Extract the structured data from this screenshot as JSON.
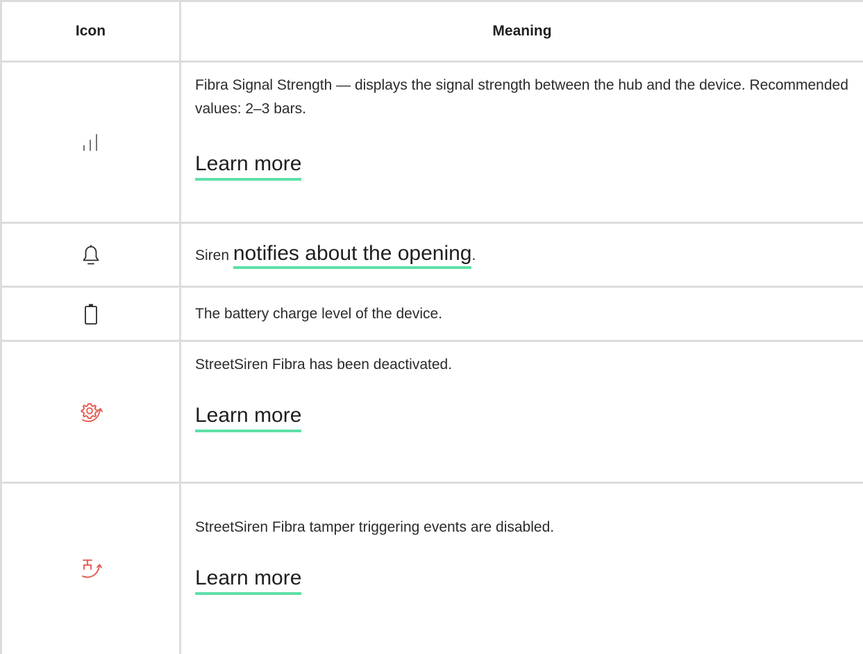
{
  "colors": {
    "border": "#dcdcdc",
    "link_underline": "#5fe0a8",
    "warning_icon": "#e4564a",
    "text": "#1f1f1f"
  },
  "table": {
    "headers": {
      "icon": "Icon",
      "meaning": "Meaning"
    },
    "rows": [
      {
        "icon": "signal-strength-icon",
        "text": "Fibra Signal Strength — displays the signal strength between the hub and the device. Recommended values: 2–3 bars.",
        "link": "Learn more"
      },
      {
        "icon": "bell-icon",
        "text_before": "Siren",
        "link": "notifies about the opening",
        "text_after": "."
      },
      {
        "icon": "battery-icon",
        "text": "The battery charge level of the device."
      },
      {
        "icon": "deactivated-gear-icon",
        "text": "StreetSiren Fibra has been deactivated.",
        "link": "Learn more"
      },
      {
        "icon": "tamper-disabled-icon",
        "text": "StreetSiren Fibra tamper triggering events are disabled.",
        "link": "Learn more"
      }
    ]
  }
}
